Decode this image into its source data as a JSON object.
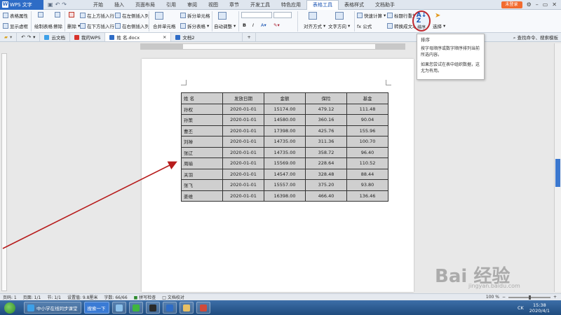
{
  "menubar": {
    "app_name": "WPS 文字",
    "tabs": [
      "开始",
      "插入",
      "页面布局",
      "引用",
      "审阅",
      "视图",
      "章节",
      "开发工具",
      "特色应用",
      "表格工具",
      "表格样式",
      "文档助手"
    ],
    "active_tab": "表格工具",
    "login_label": "未登录"
  },
  "ribbon": {
    "table_props": "表格属性",
    "show_gridlines": "显示虚框",
    "draw_table": "绘制表格",
    "erase": "擦除",
    "delete": "删除",
    "insert_above": "在上方插入行",
    "insert_below": "在下方插入行",
    "insert_left": "在左侧插入列",
    "insert_right": "在右侧插入列",
    "merge_cells": "合并单元格",
    "split_cells": "拆分单元格",
    "split_table": "拆分表格",
    "autofit": "自动调整",
    "align": "对齐方式",
    "text_direction": "文字方向",
    "quick_calc": "快速计算",
    "formula": "fx 公式",
    "repeat_header": "标题行重复",
    "convert_to_text": "转换成文本",
    "sort": "排序",
    "select": "选择"
  },
  "doctabs": {
    "tabs": [
      "云文档",
      "我的WPS",
      "姓 名.docx",
      "文档2"
    ],
    "active": "姓 名.docx",
    "search_cmd": "查找命令、搜索模板"
  },
  "tooltip": {
    "title": "排序",
    "line1": "按字母顺序或数字顺序排列当前所选内容。",
    "line2": "如果您尝试在表中组织数据，这尤为有用。"
  },
  "table": {
    "headers": [
      "姓 名",
      "发放日期",
      "金额",
      "保险",
      "基金"
    ],
    "rows": [
      [
        "孙权",
        "2020-01-01",
        "15174.00",
        "479.12",
        "111.48"
      ],
      [
        "孙策",
        "2020-01-01",
        "14580.00",
        "360.16",
        "90.04"
      ],
      [
        "曹丕",
        "2020-01-01",
        "17398.00",
        "425.76",
        "155.96"
      ],
      [
        "刘禅",
        "2020-01-01",
        "14735.00",
        "311.36",
        "100.70"
      ],
      [
        "张辽",
        "2020-01-01",
        "14735.00",
        "358.72",
        "96.40"
      ],
      [
        "周瑜",
        "2020-01-01",
        "15569.00",
        "228.64",
        "110.52"
      ],
      [
        "关羽",
        "2020-01-01",
        "14547.00",
        "328.48",
        "88.44"
      ],
      [
        "张飞",
        "2020-01-01",
        "15557.00",
        "375.20",
        "93.80"
      ],
      [
        "姜维",
        "2020-01-01",
        "16398.00",
        "466.40",
        "136.46"
      ]
    ]
  },
  "statusbar": {
    "page_no": "页码: 1",
    "page": "页面: 1/1",
    "section": "节: 1/1",
    "setting": "设置值: 9.8厘米",
    "words": "字数: 66/66",
    "spell": "拼写检查",
    "proof": "文档校对",
    "zoom": "100 %"
  },
  "taskbar": {
    "item1": "中小学在线同步课堂",
    "item2": "搜索一下",
    "lang": "CK",
    "time": "15:38",
    "date": "2020/4/1"
  },
  "watermark": {
    "text": "Bai 经验",
    "sub": "jingyan.baidu.com"
  },
  "colors": {
    "accent": "#2e6cc6",
    "annotation": "#c0272d",
    "table_fill": "#cfcfcf"
  }
}
